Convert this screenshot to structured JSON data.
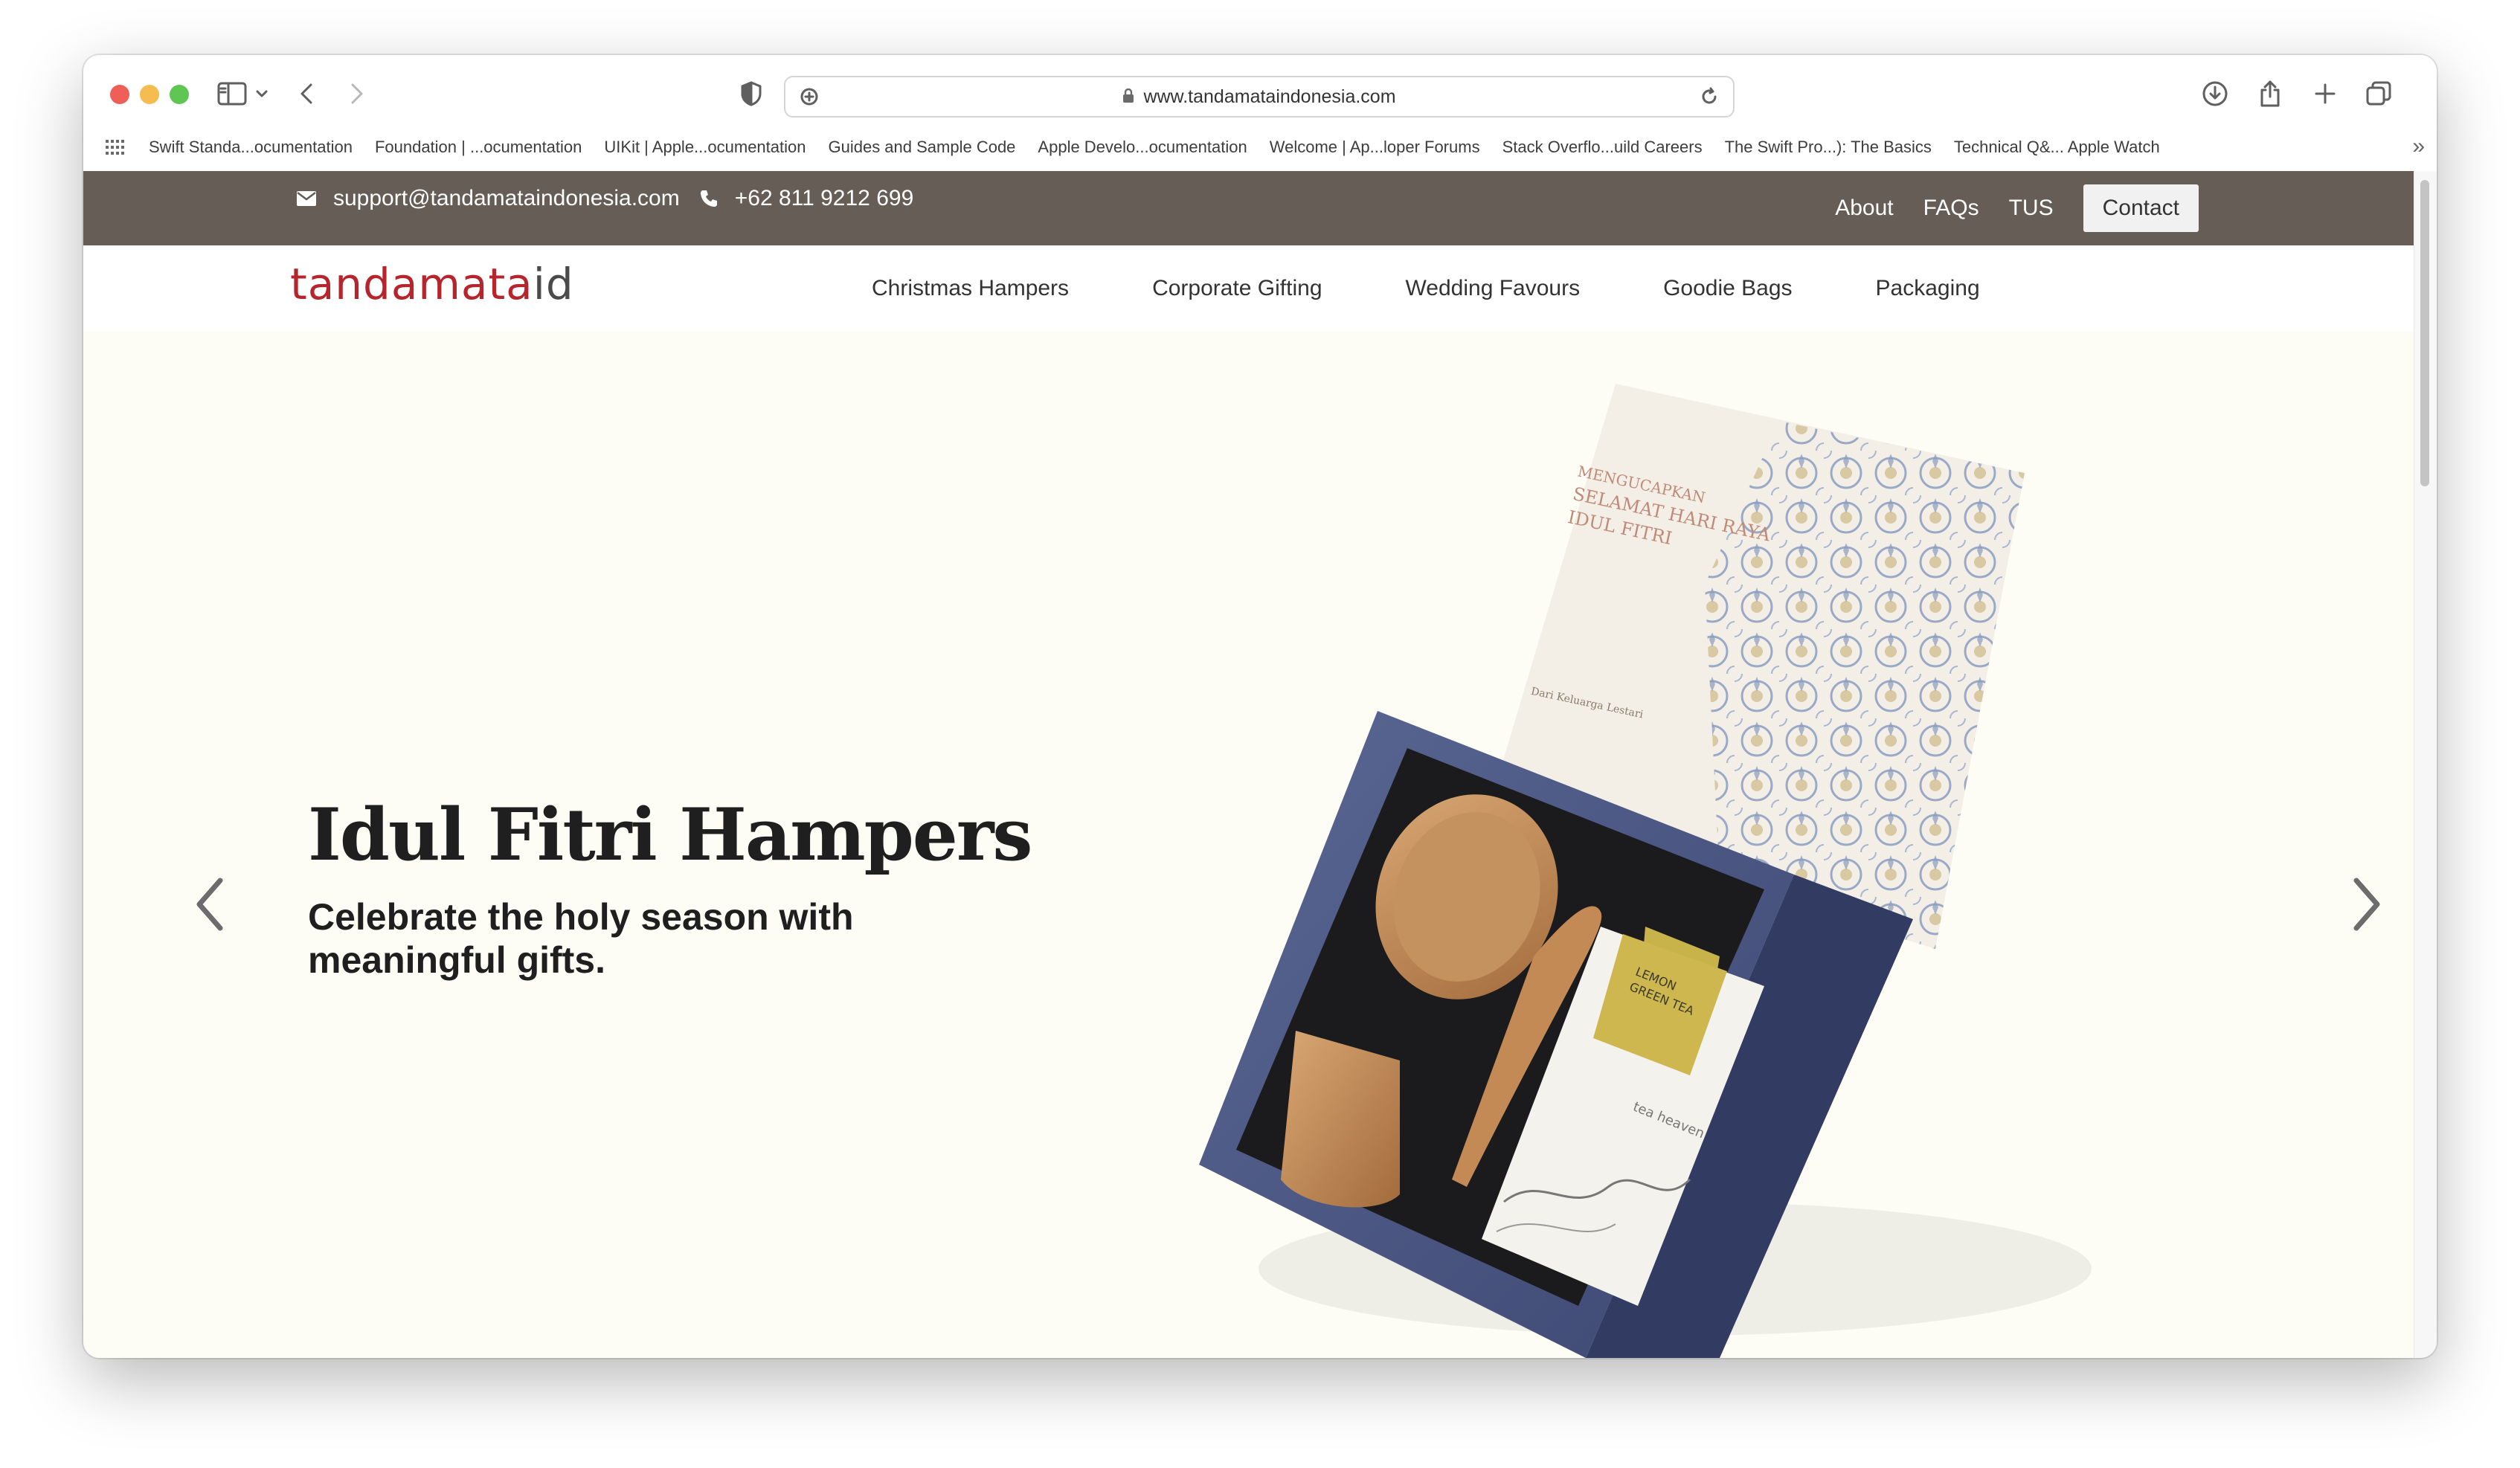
{
  "browser": {
    "url": "www.tandamataindonesia.com",
    "bookmarks": [
      "Swift Standa...ocumentation",
      "Foundation | ...ocumentation",
      "UIKit | Apple...ocumentation",
      "Guides and Sample Code",
      "Apple Develo...ocumentation",
      "Welcome | Ap...loper Forums",
      "Stack Overflo...uild Careers",
      "The Swift Pro...): The Basics",
      "Technical Q&... Apple Watch"
    ]
  },
  "topbar": {
    "email": "support@tandamataindonesia.com",
    "phone": "+62 811 9212 699",
    "links": [
      "About",
      "FAQs",
      "TUS"
    ],
    "contact_label": "Contact",
    "bg_color": "#655d56"
  },
  "nav": {
    "logo_main": "tandamata",
    "logo_suffix": "id",
    "items": [
      "Christmas Hampers",
      "Corporate Gifting",
      "Wedding Favours",
      "Goodie Bags",
      "Packaging"
    ]
  },
  "hero": {
    "title": "Idul Fitri Hampers",
    "subtitle": "Celebrate the holy season with meaningful gifts.",
    "card_text": [
      "MENGUCAPKAN",
      "SELAMAT HARI RAYA",
      "IDUL FITRI"
    ],
    "card_sign": "Dari Keluarga Lestari",
    "tea_label": [
      "LEMON",
      "GREEN TEA"
    ],
    "tea_brand": "tea heaven"
  }
}
